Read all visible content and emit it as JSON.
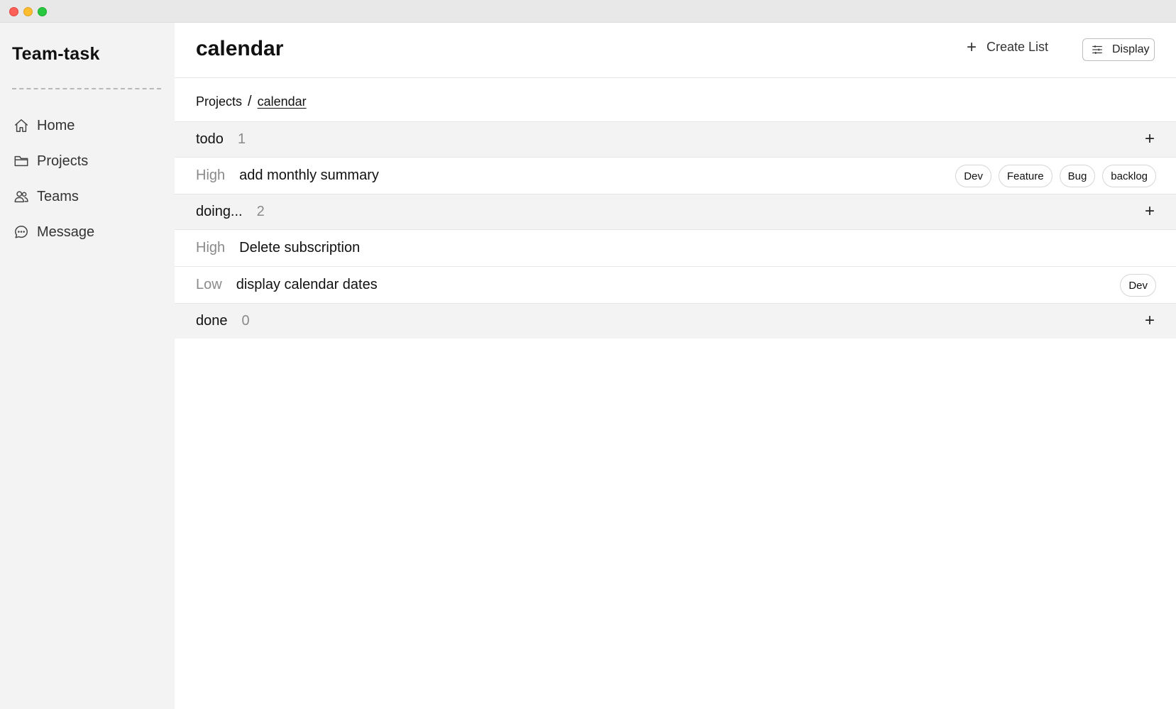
{
  "app": {
    "brand": "Team-task"
  },
  "sidebar": {
    "items": [
      {
        "label": "Home",
        "icon": "home-icon"
      },
      {
        "label": "Projects",
        "icon": "folder-icon"
      },
      {
        "label": "Teams",
        "icon": "users-icon"
      },
      {
        "label": "Message",
        "icon": "message-icon"
      }
    ]
  },
  "header": {
    "title": "calendar",
    "create_list_label": "Create List",
    "display_label": "Display"
  },
  "breadcrumb": {
    "root": "Projects",
    "separator": "/",
    "current": "calendar"
  },
  "groups": [
    {
      "name": "todo",
      "count": "1",
      "tasks": [
        {
          "priority": "High",
          "title": "add monthly summary",
          "tags": [
            "Dev",
            "Feature",
            "Bug",
            "backlog"
          ]
        }
      ]
    },
    {
      "name": "doing...",
      "count": "2",
      "tasks": [
        {
          "priority": "High",
          "title": "Delete subscription",
          "tags": []
        },
        {
          "priority": "Low",
          "title": "display calendar dates",
          "tags": [
            "Dev"
          ]
        }
      ]
    },
    {
      "name": "done",
      "count": "0",
      "tasks": []
    }
  ],
  "colors": {
    "sidebar_bg": "#f3f3f3",
    "group_header_bg": "#f3f3f3",
    "muted_text": "#8a8a8a",
    "titlebar": "#e8e8e8"
  }
}
